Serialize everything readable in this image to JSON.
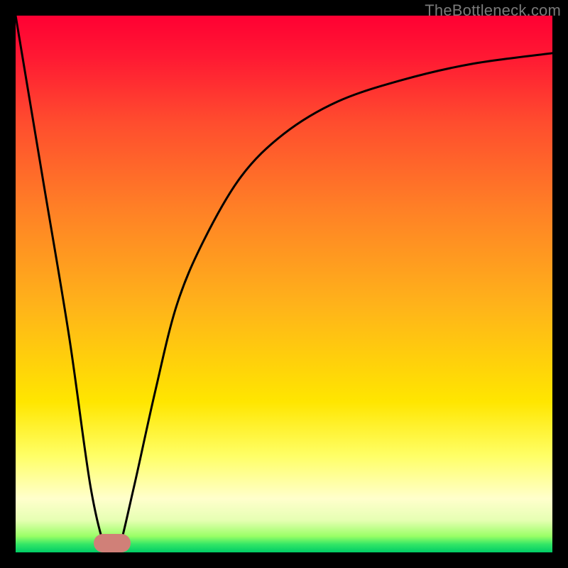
{
  "watermark": "TheBottleneck.com",
  "chart_data": {
    "type": "line",
    "title": "",
    "xlabel": "",
    "ylabel": "",
    "xlim": [
      0,
      100
    ],
    "ylim": [
      0,
      100
    ],
    "series": [
      {
        "name": "bottleneck-curve",
        "x": [
          0,
          5,
          10,
          14,
          17,
          19,
          22,
          26,
          30,
          35,
          42,
          50,
          60,
          72,
          85,
          100
        ],
        "values": [
          100,
          70,
          40,
          12,
          0,
          0,
          12,
          30,
          46,
          58,
          70,
          78,
          84,
          88,
          91,
          93
        ]
      }
    ],
    "annotations": [
      {
        "name": "optimal-zone-marker",
        "x_range": [
          15,
          21
        ],
        "y": 0
      }
    ],
    "background": "red-yellow-green vertical gradient (red top, green bottom)"
  }
}
